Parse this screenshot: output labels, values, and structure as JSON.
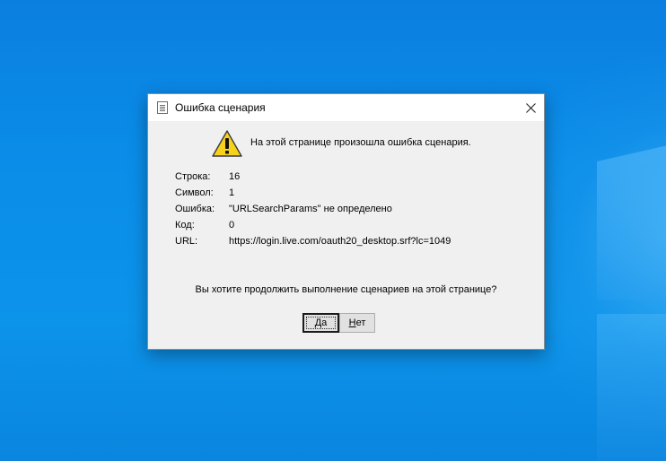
{
  "dialog": {
    "title": "Ошибка сценария",
    "message": "На этой странице произошла ошибка сценария.",
    "details": [
      {
        "label": "Строка:",
        "value": "16"
      },
      {
        "label": "Символ:",
        "value": "1"
      },
      {
        "label": "Ошибка:",
        "value": "\"URLSearchParams\" не определено"
      },
      {
        "label": "Код:",
        "value": "0"
      },
      {
        "label": "URL:",
        "value": "https://login.live.com/oauth20_desktop.srf?lc=1049"
      }
    ],
    "question": "Вы хотите продолжить выполнение сценариев на этой странице?",
    "buttons": {
      "yes": {
        "accel": "Д",
        "rest": "а"
      },
      "no": {
        "accel": "Н",
        "rest": "ет"
      }
    }
  },
  "colors": {
    "desktop_accent": "#0a8de8",
    "warning_yellow": "#f6d31a"
  },
  "icons": {
    "title": "document-icon",
    "close": "close-icon",
    "warning": "warning-icon"
  }
}
